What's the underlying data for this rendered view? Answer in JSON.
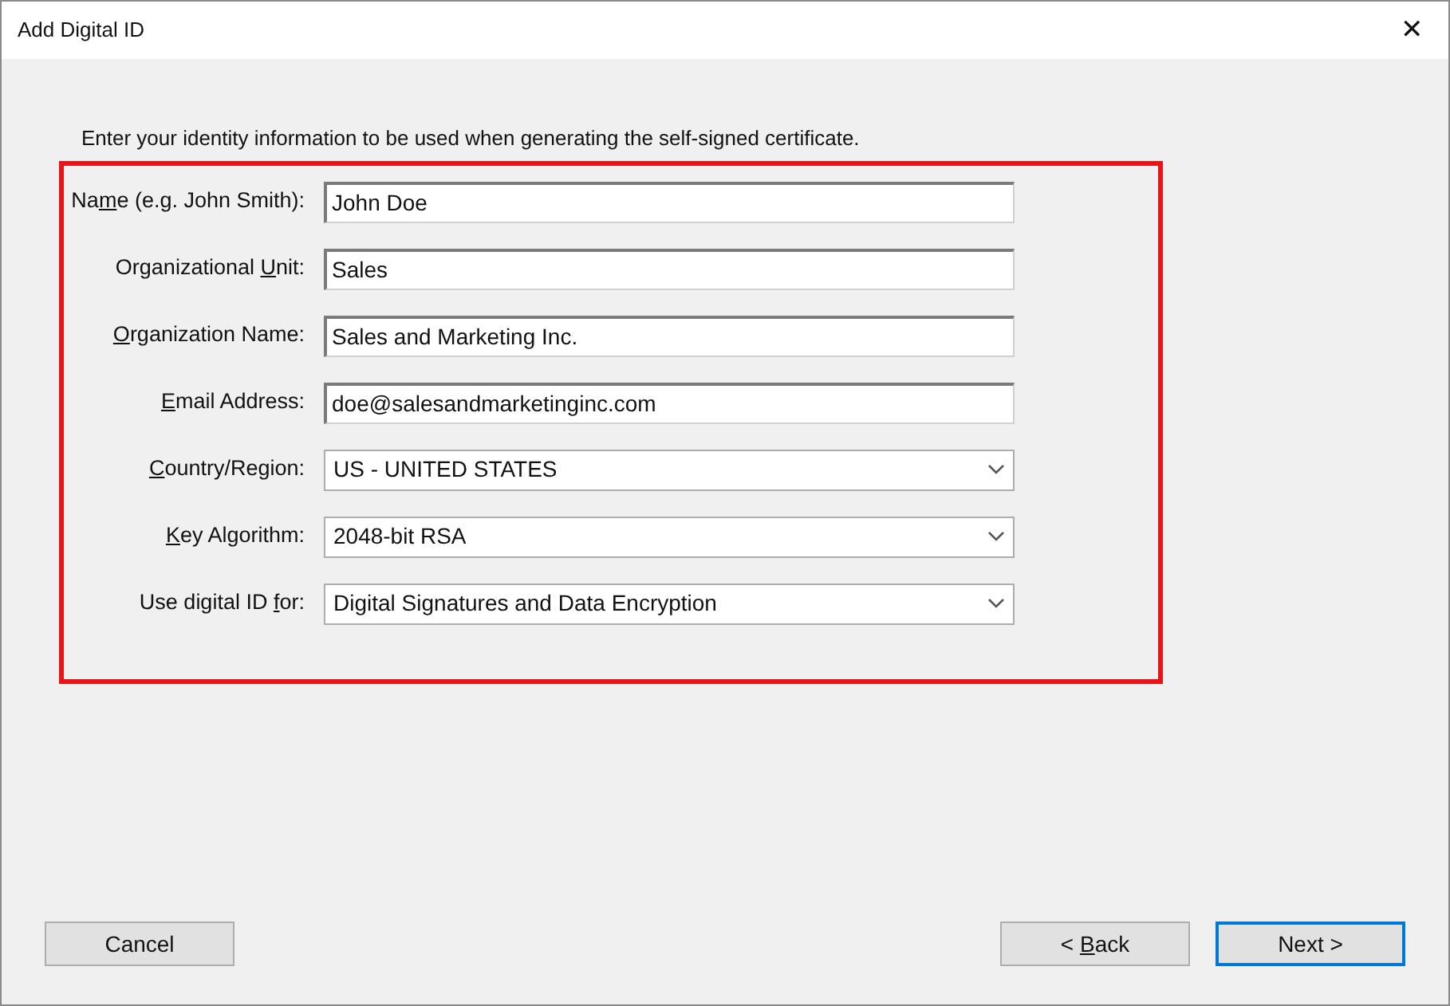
{
  "window": {
    "title": "Add Digital ID",
    "close": "✕"
  },
  "intro": "Enter your identity information to be used when generating the self-signed certificate.",
  "form": {
    "highlighted": true,
    "fields": [
      {
        "kind": "text",
        "label": {
          "before": "Na",
          "key": "m",
          "after": "e (e.g. John Smith):"
        },
        "value": "John Doe"
      },
      {
        "kind": "text",
        "label": {
          "before": "Organizational ",
          "key": "U",
          "after": "nit:"
        },
        "value": "Sales"
      },
      {
        "kind": "text",
        "label": {
          "key": "O",
          "after": "rganization Name:"
        },
        "value": "Sales and Marketing Inc."
      },
      {
        "kind": "text",
        "label": {
          "key": "E",
          "after": "mail Address:"
        },
        "value": "doe@salesandmarketinginc.com"
      },
      {
        "kind": "select",
        "label": {
          "key": "C",
          "after": "ountry/Region:"
        },
        "value": "US - UNITED STATES"
      },
      {
        "kind": "select",
        "label": {
          "key": "K",
          "after": "ey Algorithm:"
        },
        "value": "2048-bit RSA"
      },
      {
        "kind": "select",
        "label": {
          "before": "Use digital ID ",
          "key": "f",
          "after": "or:"
        },
        "value": "Digital Signatures and Data Encryption"
      }
    ]
  },
  "left_buttons": [
    {
      "label": {
        "before": "Cancel"
      },
      "default": false
    }
  ],
  "right_buttons": [
    {
      "label": {
        "before": "< ",
        "key": "B",
        "after": "ack"
      },
      "default": false
    },
    {
      "label": {
        "before": "Next >"
      },
      "default": true
    }
  ]
}
